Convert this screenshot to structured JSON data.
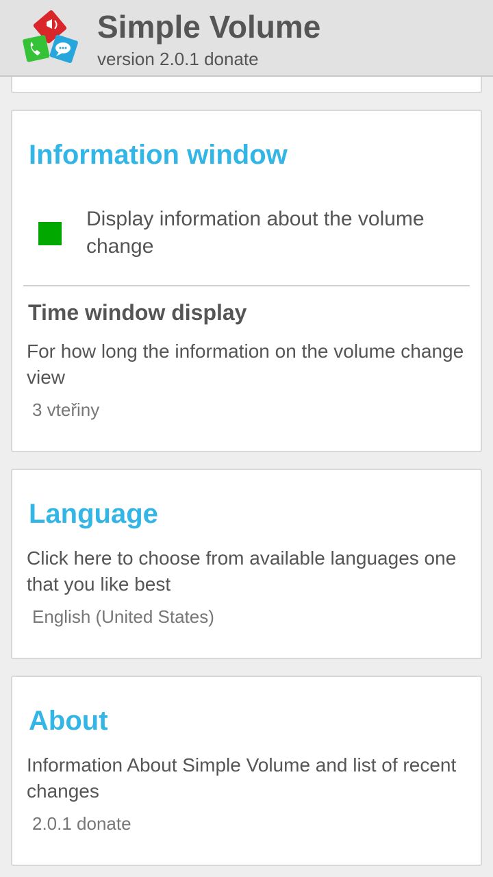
{
  "header": {
    "title": "Simple Volume",
    "version": "version 2.0.1 donate",
    "logo_icon": "app-logo-icon"
  },
  "information_window": {
    "title": "Information window",
    "display_info": {
      "label": "Display information about the volume change",
      "checked": true,
      "check_color": "#00a800"
    },
    "time_window": {
      "title": "Time window display",
      "description": "For how long the information on the volume change view",
      "value": "3 vteřiny"
    }
  },
  "language": {
    "title": "Language",
    "description": "Click here to choose from available languages one that you like best",
    "value": "English (United States)"
  },
  "about": {
    "title": "About",
    "description": "Information About Simple Volume and list of recent changes",
    "value": "2.0.1 donate"
  },
  "colors": {
    "accent": "#33b5e5",
    "text": "#555555",
    "background": "#eeeeee"
  }
}
